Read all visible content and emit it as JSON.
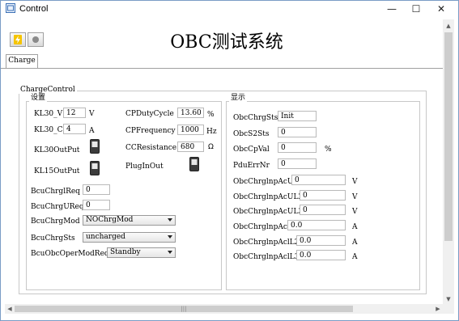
{
  "window": {
    "title": "Control",
    "controls": {
      "minimize": "—",
      "maximize": "☐",
      "close": "✕"
    }
  },
  "app": {
    "title": "OBC测试系统"
  },
  "toolbar": {
    "buttons": [
      {
        "icon": "lightning-icon"
      },
      {
        "icon": "record-icon"
      }
    ]
  },
  "tabs": [
    {
      "label": "Charge"
    }
  ],
  "charge_control": {
    "title": "ChargeControl",
    "settings": {
      "title": "设置",
      "kl30_v": {
        "label": "KL30_V",
        "value": "12",
        "unit": "V"
      },
      "kl30_c": {
        "label": "KL30_C",
        "value": "4",
        "unit": "A"
      },
      "kl30_output": {
        "label": "KL30OutPut"
      },
      "kl15_output": {
        "label": "KL15OutPut"
      },
      "cp_duty": {
        "label": "CPDutyCycle",
        "value": "13.60",
        "unit": "%"
      },
      "cp_freq": {
        "label": "CPFrequency",
        "value": "1000",
        "unit": "Hz"
      },
      "cc_res": {
        "label": "CCResistance",
        "value": "680",
        "unit": "Ω"
      },
      "plug_in_out": {
        "label": "PlugInOut"
      },
      "bcu_chrgl_req": {
        "label": "BcuChrglReq",
        "value": "0"
      },
      "bcu_chrgu_req": {
        "label": "BcuChrgUReq",
        "value": "0"
      },
      "bcu_chrg_mod": {
        "label": "BcuChrgMod",
        "value": "NOChrgMod"
      },
      "bcu_chrg_sts": {
        "label": "BcuChrgSts",
        "value": "uncharged"
      },
      "bcu_obc_oper": {
        "label": "BcuObcOperModReq",
        "value": "Standby"
      }
    },
    "display": {
      "title": "显示",
      "rows": [
        {
          "label": "ObcChrgSts",
          "value": "Init",
          "unit": ""
        },
        {
          "label": "ObcS2Sts",
          "value": "0",
          "unit": ""
        },
        {
          "label": "ObcCpVal",
          "value": "0",
          "unit": "%"
        },
        {
          "label": "PduErrNr",
          "value": "0",
          "unit": ""
        },
        {
          "label": "ObcChrglnpAcU",
          "value": "0",
          "unit": "V"
        },
        {
          "label": "ObcChrglnpAcUL2",
          "value": "0",
          "unit": "V"
        },
        {
          "label": "ObcChrglnpAcUL3",
          "value": "0",
          "unit": "V"
        },
        {
          "label": "ObcChrglnpAcl",
          "value": "0.0",
          "unit": "A"
        },
        {
          "label": "ObcChrglnpAclL2",
          "value": "0.0",
          "unit": "A"
        },
        {
          "label": "ObcChrglnpAclL3",
          "value": "0.0",
          "unit": "A"
        }
      ]
    }
  },
  "scrollbars": {
    "left_arrow": "◀",
    "right_arrow": "▶",
    "up_arrow": "▲",
    "down_arrow": "▼",
    "grip": "|||"
  }
}
